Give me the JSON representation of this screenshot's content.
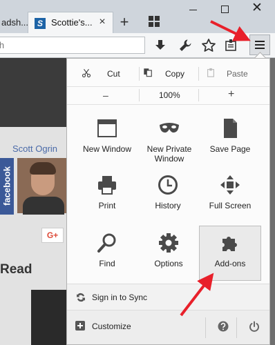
{
  "tabs": {
    "previous_tab_label": "adsh...",
    "active_tab_label": "Scottie's...",
    "favicon_letter": "S",
    "close_glyph": "×",
    "new_tab_glyph": "+"
  },
  "window_controls": {
    "close_glyph": "✕"
  },
  "navbar": {
    "search_placeholder": "rch"
  },
  "page": {
    "author_name": "Scott Ogrin",
    "facebook_label": "facebook",
    "gplus_label": "G+",
    "heading": "Read"
  },
  "menu": {
    "edit": {
      "cut_label": "Cut",
      "copy_label": "Copy",
      "paste_label": "Paste"
    },
    "zoom": {
      "minus_label": "–",
      "level": "100%",
      "plus_label": "+"
    },
    "grid": [
      {
        "label": "New Window",
        "icon": "new-window-icon"
      },
      {
        "label": "New Private\nWindow",
        "icon": "private-mask-icon"
      },
      {
        "label": "Save Page",
        "icon": "save-page-icon"
      },
      {
        "label": "Print",
        "icon": "printer-icon"
      },
      {
        "label": "History",
        "icon": "clock-icon"
      },
      {
        "label": "Full Screen",
        "icon": "fullscreen-icon"
      },
      {
        "label": "Find",
        "icon": "magnifier-icon"
      },
      {
        "label": "Options",
        "icon": "gear-icon"
      },
      {
        "label": "Add-ons",
        "icon": "puzzle-piece-icon"
      }
    ],
    "sync_label": "Sign in to Sync",
    "customize_label": "Customize"
  },
  "colors": {
    "accent_arrow": "#e8202a",
    "menu_bg": "#fbfbfb",
    "icon_gray": "#4a4a4a"
  }
}
